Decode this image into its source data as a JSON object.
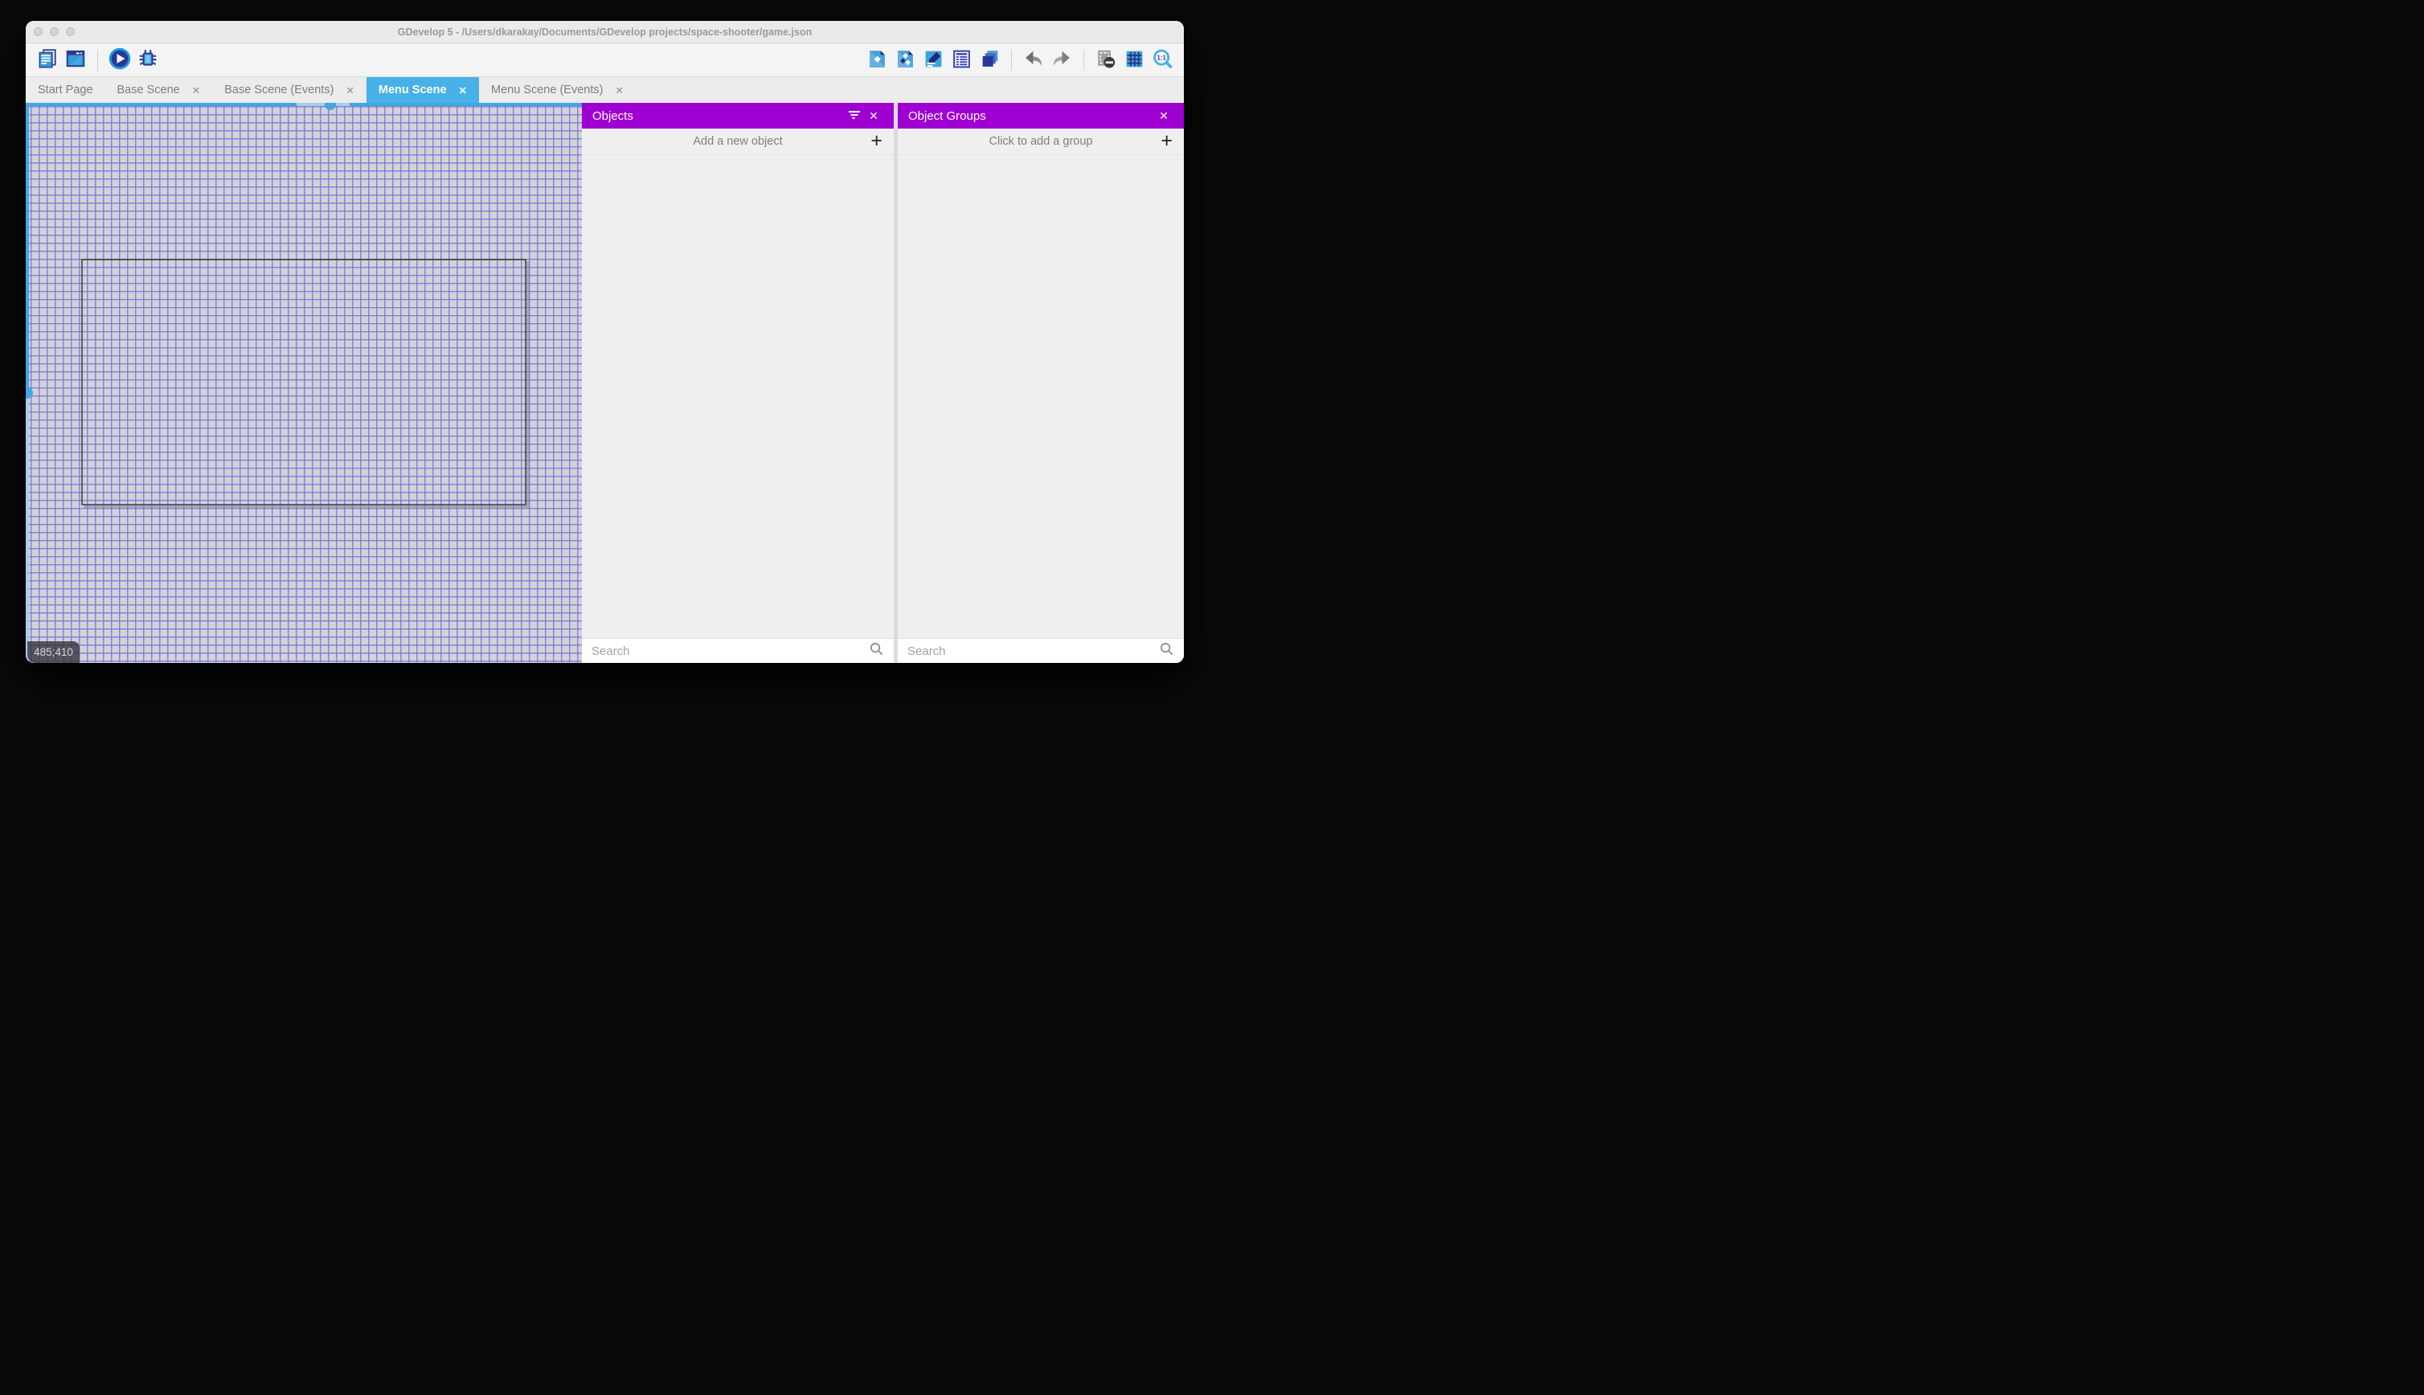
{
  "window": {
    "title": "GDevelop 5 - /Users/dkarakay/Documents/GDevelop projects/space-shooter/game.json"
  },
  "glyphs": {
    "close": "✕",
    "plus": "+"
  },
  "toolbar": {
    "left_icons": [
      "stacked-pages-icon",
      "app-window-icon",
      "play-icon",
      "bug-icon"
    ],
    "right_icons": [
      "objects-document-icon",
      "object-groups-document-icon",
      "properties-pencil-icon",
      "instances-list-icon",
      "layers-icon",
      "undo-arrow-icon",
      "redo-arrow-icon",
      "window-mask-icon",
      "grid-icon",
      "zoom-1-1-icon"
    ]
  },
  "tabs": [
    {
      "label": "Start Page",
      "closable": false,
      "active": false
    },
    {
      "label": "Base Scene",
      "closable": true,
      "active": false
    },
    {
      "label": "Base Scene (Events)",
      "closable": true,
      "active": false
    },
    {
      "label": "Menu Scene",
      "closable": true,
      "active": true
    },
    {
      "label": "Menu Scene (Events)",
      "closable": true,
      "active": false
    }
  ],
  "canvas": {
    "coordinates": "485;410"
  },
  "panels": {
    "objects": {
      "title": "Objects",
      "add_label": "Add a new object",
      "search_placeholder": "Search"
    },
    "object_groups": {
      "title": "Object Groups",
      "add_label": "Click to add a group",
      "search_placeholder": "Search"
    }
  },
  "colors": {
    "accent_purple": "#9E00D2",
    "active_tab_blue": "#47B1E8",
    "scrollbar_blue": "#3FA8DF",
    "grid_line": "#7070E0",
    "canvas_bg": "#D3D3D6"
  }
}
